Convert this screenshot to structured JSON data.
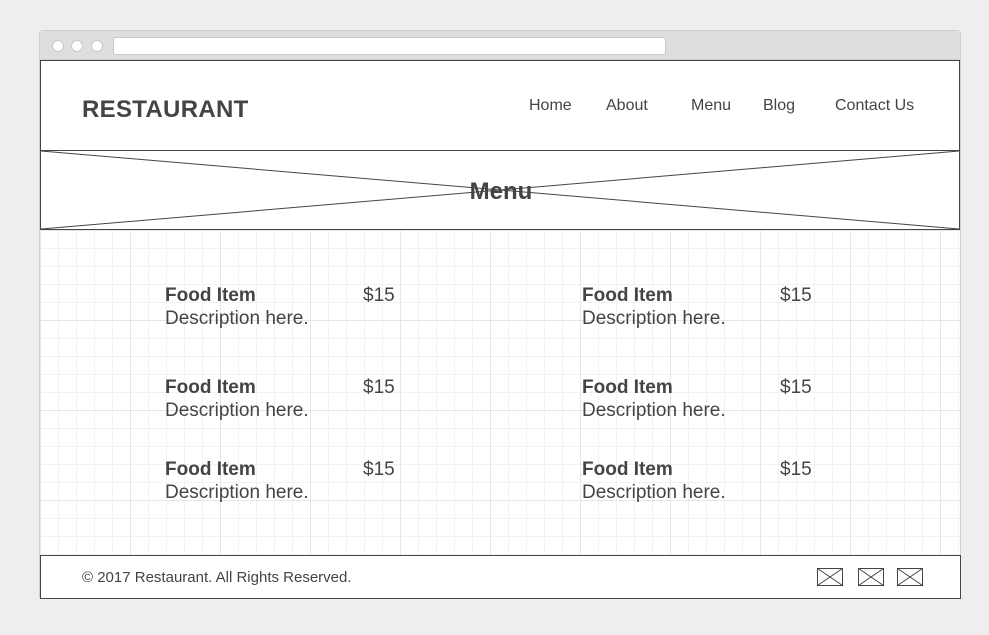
{
  "header": {
    "brand": "RESTAURANT",
    "nav": [
      "Home",
      "About",
      "Menu",
      "Blog",
      "Contact Us"
    ]
  },
  "hero": {
    "title": "Menu"
  },
  "menu": {
    "items": [
      {
        "name": "Food Item",
        "price": "$15",
        "description": "Description here."
      },
      {
        "name": "Food Item",
        "price": "$15",
        "description": "Description here."
      },
      {
        "name": "Food Item",
        "price": "$15",
        "description": "Description here."
      },
      {
        "name": "Food Item",
        "price": "$15",
        "description": "Description here."
      },
      {
        "name": "Food Item",
        "price": "$15",
        "description": "Description here."
      },
      {
        "name": "Food Item",
        "price": "$15",
        "description": "Description here."
      }
    ]
  },
  "footer": {
    "copyright": "© 2017 Restaurant. All Rights Reserved.",
    "social_icons": [
      "image-placeholder-icon",
      "image-placeholder-icon",
      "image-placeholder-icon"
    ]
  },
  "colors": {
    "text": "#444444",
    "background": "#eeeeee",
    "grid": "#e6e6e6"
  }
}
